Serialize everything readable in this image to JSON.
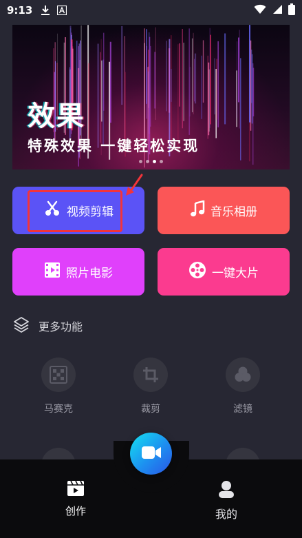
{
  "status_bar": {
    "time": "9:13",
    "left_icons": [
      "download-icon",
      "font-icon"
    ],
    "right_icons": [
      "wifi-icon",
      "signal-icon",
      "battery-icon"
    ]
  },
  "banner": {
    "title": "效果",
    "subtitle": "特殊效果 一键轻松实现",
    "page_count": 4,
    "active_page": 2
  },
  "actions": {
    "video_edit": {
      "label": "视频剪辑",
      "icon": "scissors-icon",
      "color": "#5b53f6"
    },
    "music_album": {
      "label": "音乐相册",
      "icon": "music-note-icon",
      "color": "#fb5657"
    },
    "photo_movie": {
      "label": "照片电影",
      "icon": "film-icon",
      "color": "#e040fb"
    },
    "one_key": {
      "label": "一键大片",
      "icon": "film-reel-icon",
      "color": "#fb3b8f"
    }
  },
  "more": {
    "header": "更多功能",
    "features": [
      {
        "label": "马赛克",
        "icon": "mosaic-icon"
      },
      {
        "label": "裁剪",
        "icon": "crop-icon"
      },
      {
        "label": "滤镜",
        "icon": "filter-icon"
      }
    ]
  },
  "nav": {
    "create": {
      "label": "创作",
      "icon": "clapperboard-icon"
    },
    "mine": {
      "label": "我的",
      "icon": "person-icon"
    },
    "fab_icon": "video-camera-icon"
  },
  "colors": {
    "background": "#272733",
    "highlight": "#f3343a",
    "nav_background": "#0b0b0d"
  }
}
